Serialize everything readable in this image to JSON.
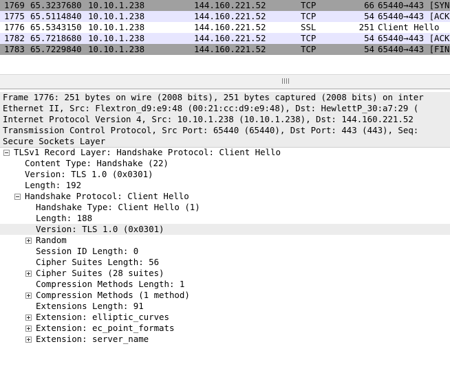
{
  "packet_list": {
    "rows": [
      {
        "no": "1769",
        "time": "65.3237680",
        "src": "10.10.1.238",
        "dst": "144.160.221.52",
        "proto": "TCP",
        "len": "66",
        "info": "65440→443 [SYN"
      },
      {
        "no": "1775",
        "time": "65.5114840",
        "src": "10.10.1.238",
        "dst": "144.160.221.52",
        "proto": "TCP",
        "len": "54",
        "info": "65440→443 [ACK"
      },
      {
        "no": "1776",
        "time": "65.5343150",
        "src": "10.10.1.238",
        "dst": "144.160.221.52",
        "proto": "SSL",
        "len": "251",
        "info": "Client Hello"
      },
      {
        "no": "1782",
        "time": "65.7218680",
        "src": "10.10.1.238",
        "dst": "144.160.221.52",
        "proto": "TCP",
        "len": "54",
        "info": "65440→443 [ACK"
      },
      {
        "no": "1783",
        "time": "65.7229840",
        "src": "10.10.1.238",
        "dst": "144.160.221.52",
        "proto": "TCP",
        "len": "54",
        "info": "65440→443 [FIN"
      }
    ]
  },
  "details": {
    "frame": "Frame 1776: 251 bytes on wire (2008 bits), 251 bytes captured (2008 bits) on inter",
    "ethernet": "Ethernet II, Src: Flextron_d9:e9:48 (00:21:cc:d9:e9:48), Dst: HewlettP_30:a7:29 (",
    "ip": "Internet Protocol Version 4, Src: 10.10.1.238 (10.10.1.238), Dst: 144.160.221.52",
    "tcp": "Transmission Control Protocol, Src Port: 65440 (65440), Dst Port: 443 (443), Seq:",
    "ssl": "Secure Sockets Layer",
    "record_layer": "TLSv1 Record Layer: Handshake Protocol: Client Hello",
    "content_type": "Content Type: Handshake (22)",
    "record_version": "Version: TLS 1.0 (0x0301)",
    "record_length": "Length: 192",
    "handshake": "Handshake Protocol: Client Hello",
    "handshake_type": "Handshake Type: Client Hello (1)",
    "handshake_length": "Length: 188",
    "handshake_version": "Version: TLS 1.0 (0x0301)",
    "random": "Random",
    "session_id_length": "Session ID Length: 0",
    "cipher_suites_length": "Cipher Suites Length: 56",
    "cipher_suites": "Cipher Suites (28 suites)",
    "compression_methods_length": "Compression Methods Length: 1",
    "compression_methods": "Compression Methods (1 method)",
    "extensions_length": "Extensions Length: 91",
    "ext_elliptic_curves": "Extension: elliptic_curves",
    "ext_ec_point_formats": "Extension: ec_point_formats",
    "ext_server_name": "Extension: server_name"
  }
}
